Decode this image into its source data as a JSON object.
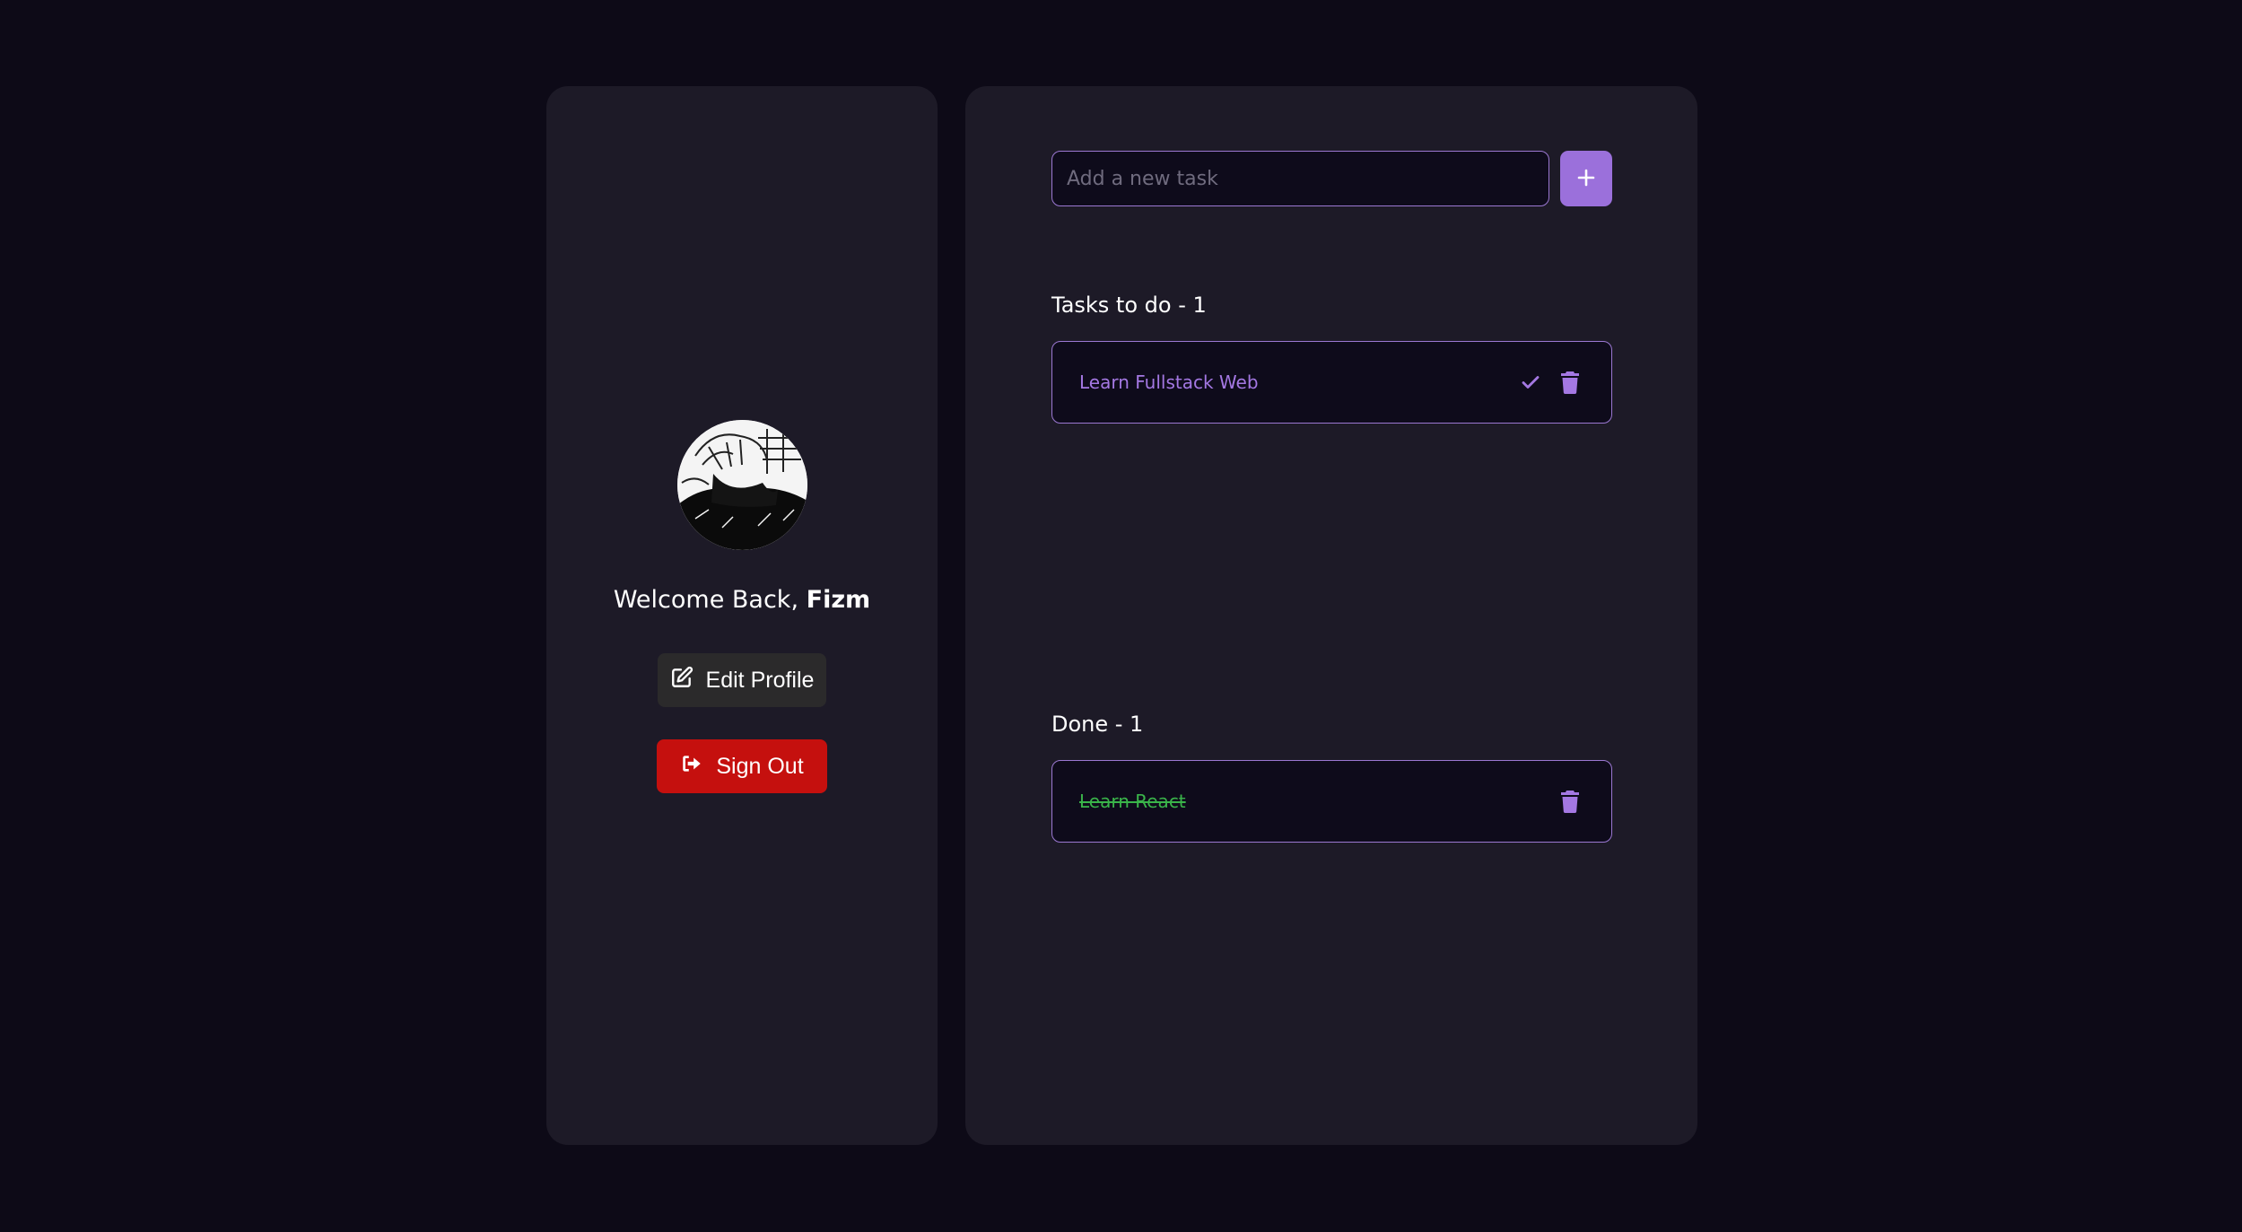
{
  "profile": {
    "welcome_prefix": "Welcome Back, ",
    "username": "Fizm",
    "edit_label": "Edit Profile",
    "signout_label": "Sign Out"
  },
  "new_task": {
    "placeholder": "Add a new task",
    "value": ""
  },
  "todo": {
    "title": "Tasks to do - 1",
    "items": [
      {
        "text": "Learn Fullstack Web"
      }
    ]
  },
  "done": {
    "title": "Done - 1",
    "items": [
      {
        "text": "Learn React"
      }
    ]
  },
  "colors": {
    "background": "#0d0a17",
    "card": "#1d1a27",
    "accent": "#9b70db",
    "danger": "#c5100e",
    "done_text": "#3ab44a"
  }
}
